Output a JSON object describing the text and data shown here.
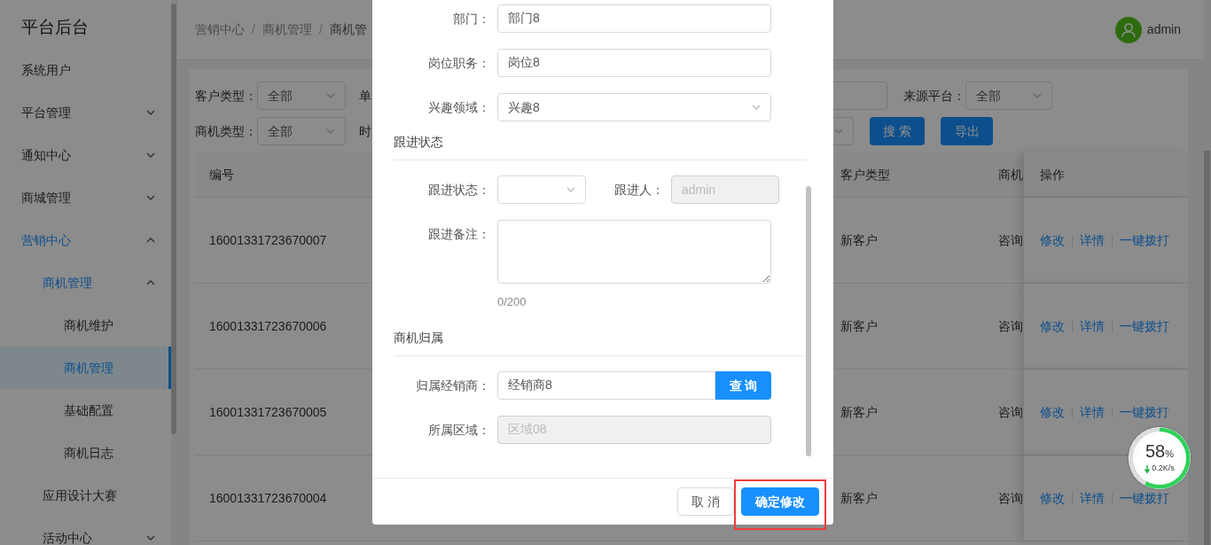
{
  "sidebar": {
    "title": "平台后台",
    "items": [
      {
        "label": "系统用户",
        "kind": "leaf",
        "selected": false
      },
      {
        "label": "平台管理",
        "kind": "group",
        "expanded": false,
        "selected": false
      },
      {
        "label": "通知中心",
        "kind": "group",
        "expanded": false,
        "selected": false
      },
      {
        "label": "商城管理",
        "kind": "group",
        "expanded": false,
        "selected": false
      },
      {
        "label": "营销中心",
        "kind": "group",
        "expanded": true,
        "selected": false,
        "children": [
          {
            "label": "商机管理",
            "kind": "group",
            "expanded": true,
            "selected": false,
            "children": [
              {
                "label": "商机维护",
                "kind": "leaf",
                "selected": false
              },
              {
                "label": "商机管理",
                "kind": "leaf",
                "selected": true
              },
              {
                "label": "基础配置",
                "kind": "leaf",
                "selected": false
              },
              {
                "label": "商机日志",
                "kind": "leaf",
                "selected": false
              }
            ]
          },
          {
            "label": "应用设计大赛",
            "kind": "leaf",
            "selected": false
          },
          {
            "label": "活动中心",
            "kind": "group",
            "expanded": false,
            "selected": false
          }
        ]
      }
    ]
  },
  "header": {
    "breadcrumb": [
      {
        "kind": "link",
        "text": "营销中心"
      },
      {
        "kind": "separator",
        "text": "/"
      },
      {
        "kind": "link",
        "text": "商机管理"
      },
      {
        "kind": "separator",
        "text": "/"
      },
      {
        "kind": "current",
        "text": "商机管"
      }
    ],
    "user": "admin"
  },
  "filters": [
    {
      "left": [
        {
          "kind": "select",
          "label": "客户类型：",
          "value": "全部"
        },
        {
          "kind": "label",
          "label": "单"
        }
      ],
      "right": [
        {
          "kind": "input"
        },
        {
          "kind": "select",
          "label": "来源平台：",
          "value": "全部"
        }
      ]
    },
    {
      "left": [
        {
          "kind": "select",
          "label": "商机类型：",
          "value": "全部"
        },
        {
          "kind": "label",
          "label": "时"
        }
      ],
      "right": [
        {
          "kind": "select"
        },
        {
          "kind": "button",
          "label": "搜 索"
        },
        {
          "kind": "button",
          "label": "导出"
        }
      ]
    }
  ],
  "table": {
    "columns": [
      "编号",
      "客户类型",
      "商机",
      "操作"
    ],
    "rows": [
      {
        "id": "16001331723670007",
        "customer_type": "新客户",
        "column_3": "咨询",
        "actions": [
          "修改",
          "详情",
          "一键拨打"
        ]
      },
      {
        "id": "16001331723670006",
        "customer_type": "新客户",
        "column_3": "咨询",
        "actions": [
          "修改",
          "详情",
          "一键拨打"
        ]
      },
      {
        "id": "16001331723670005",
        "customer_type": "新客户",
        "column_3": "咨询",
        "actions": [
          "修改",
          "详情",
          "一键拨打"
        ]
      },
      {
        "id": "16001331723670004",
        "customer_type": "新客户",
        "column_3": "咨询",
        "actions": [
          "修改",
          "详情",
          "一键拨打"
        ]
      }
    ]
  },
  "dialog": {
    "sections": [
      {
        "rows": [
          [
            {
              "kind": "input",
              "label": "部门：",
              "value": "部门8",
              "disabled": false
            }
          ],
          [
            {
              "kind": "input",
              "label": "岗位职务：",
              "value": "岗位8",
              "disabled": false
            }
          ],
          [
            {
              "kind": "select",
              "label": "兴趣领域：",
              "value": "兴趣8",
              "disabled": false
            }
          ]
        ]
      },
      {
        "title": "跟进状态",
        "rows": [
          [
            {
              "kind": "select",
              "label": "跟进状态：",
              "disabled": false
            },
            {
              "kind": "input",
              "label": "跟进人：",
              "value": "admin",
              "disabled": true
            }
          ],
          [
            {
              "kind": "textarea",
              "label": "跟进备注：",
              "disabled": false,
              "counter": "0/200"
            }
          ]
        ]
      },
      {
        "title": "商机归属",
        "rows": [
          [
            {
              "kind": "search",
              "label": "归属经销商：",
              "value": "经销商8",
              "button": "查 询",
              "disabled": false
            }
          ],
          [
            {
              "kind": "input",
              "label": "所属区域：",
              "value": "区域08",
              "disabled": true
            }
          ]
        ]
      }
    ],
    "buttons": [
      {
        "label": "取 消",
        "kind": "default",
        "highlighted": false
      },
      {
        "label": "确定修改",
        "kind": "primary",
        "highlighted": true
      }
    ]
  },
  "speed_widget": {
    "level": 0.58,
    "value": "58",
    "unit": "%",
    "speed": "0.2K/s"
  }
}
